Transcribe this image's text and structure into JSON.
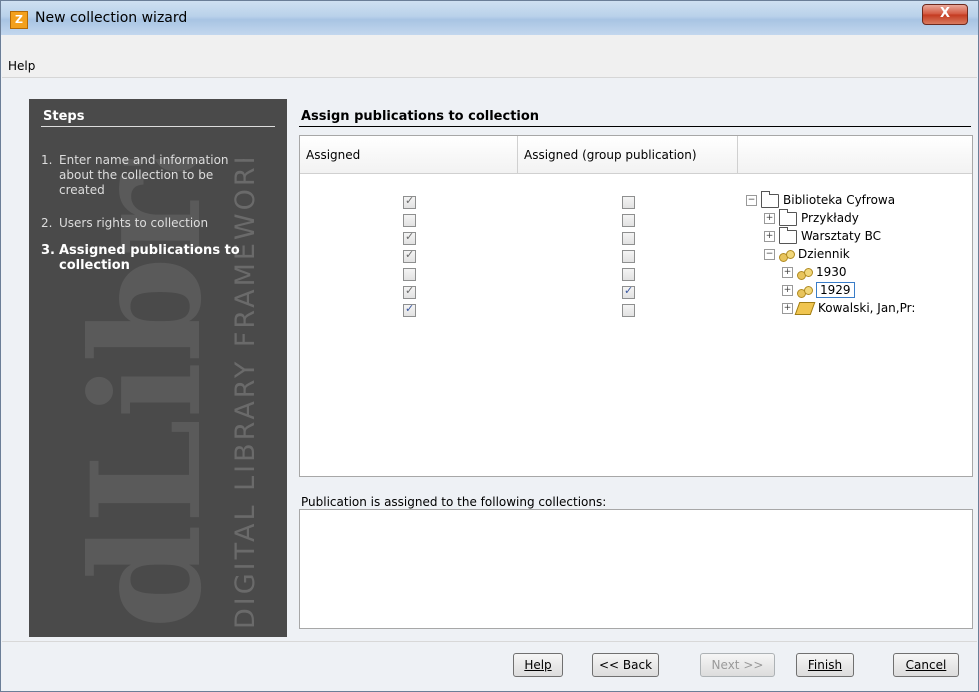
{
  "window": {
    "title": "New collection wizard",
    "close_label": "X"
  },
  "menubar": {
    "help": "Help"
  },
  "steps": {
    "header": "Steps",
    "items": [
      {
        "num": "1.",
        "label": "Enter name and information about the collection to be created"
      },
      {
        "num": "2.",
        "label": "Users rights to collection"
      },
      {
        "num": "3.",
        "label": "Assigned publications to collection"
      }
    ],
    "watermark_main": "dLibra",
    "watermark_sub": "DIGITAL LIBRARY FRAMEWORK"
  },
  "content": {
    "title": "Assign publications to collection",
    "columns": [
      "Assigned",
      "Assigned (group publication)",
      ""
    ],
    "rows": [
      {
        "assigned": true,
        "assigned_disabled": true,
        "group": false,
        "group_disabled": true
      },
      {
        "assigned": false,
        "assigned_disabled": true,
        "group": false,
        "group_disabled": true
      },
      {
        "assigned": true,
        "assigned_disabled": true,
        "group": false,
        "group_disabled": true
      },
      {
        "assigned": true,
        "assigned_disabled": true,
        "group": false,
        "group_disabled": true
      },
      {
        "assigned": false,
        "assigned_disabled": true,
        "group": false,
        "group_disabled": true
      },
      {
        "assigned": true,
        "assigned_disabled": true,
        "group": true,
        "group_disabled": false
      },
      {
        "assigned": true,
        "assigned_disabled": false,
        "group": false,
        "group_disabled": true
      }
    ],
    "tree": [
      {
        "label": "Biblioteka Cyfrowa",
        "type": "folder",
        "toggle": "−",
        "level": 0
      },
      {
        "label": "Przykłady",
        "type": "folder",
        "toggle": "+",
        "level": 1
      },
      {
        "label": "Warsztaty BC",
        "type": "folder",
        "toggle": "+",
        "level": 1
      },
      {
        "label": "Dziennik",
        "type": "collection",
        "toggle": "−",
        "level": 1
      },
      {
        "label": "1930",
        "type": "collection",
        "toggle": "+",
        "level": 2
      },
      {
        "label": "1929",
        "type": "collection",
        "toggle": "+",
        "level": 2,
        "selected": true
      },
      {
        "label": "Kowalski, Jan,Pr:",
        "type": "book",
        "toggle": "+",
        "level": 2
      }
    ],
    "pub_label": "Publication is assigned to the following collections:"
  },
  "buttons": {
    "help": "Help",
    "back": "<< Back",
    "next": "Next >>",
    "finish": "Finish",
    "cancel": "Cancel"
  }
}
